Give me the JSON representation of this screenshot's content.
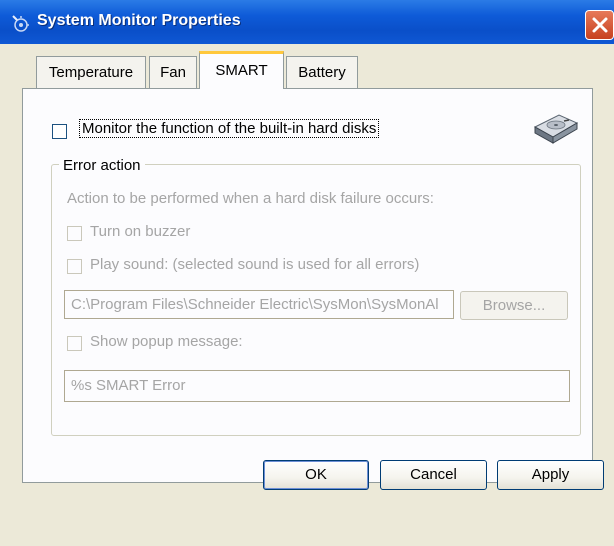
{
  "window": {
    "title": "System Monitor Properties"
  },
  "tabs": [
    {
      "label": "Temperature"
    },
    {
      "label": "Fan"
    },
    {
      "label": "SMART"
    },
    {
      "label": "Battery"
    }
  ],
  "smart": {
    "monitor_label": "Monitor the function of the built-in hard disks",
    "monitor_checked": false,
    "error_action": {
      "legend": "Error action",
      "description": "Action to be performed when a hard disk failure occurs:",
      "buzzer_label": "Turn on buzzer",
      "sound_label": "Play sound:  (selected sound is used for all errors)",
      "sound_path": "C:\\Program Files\\Schneider Electric\\SysMon\\SysMonAl",
      "browse_label": "Browse...",
      "popup_label": "Show popup message:",
      "popup_message": "%s SMART Error"
    }
  },
  "buttons": {
    "ok": "OK",
    "cancel": "Cancel",
    "apply": "Apply"
  },
  "icons": {
    "app": "system-monitor-icon",
    "close": "close-icon",
    "disk": "hard-disk-icon"
  },
  "colors": {
    "titlebar": "#0a4fc9",
    "close": "#c7411f",
    "active_tab_accent": "#ffc83c",
    "dialog_bg": "#ece9d8"
  }
}
